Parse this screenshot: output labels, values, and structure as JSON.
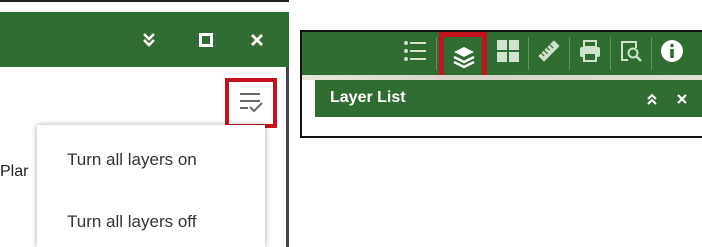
{
  "left_panel": {
    "header_icons": [
      "chevron-double-down-icon",
      "maximize-icon",
      "close-icon"
    ],
    "filter_icon": "layer-options-icon",
    "partial_text": "Plar",
    "menu": {
      "items": [
        {
          "label": "Turn all layers on"
        },
        {
          "label": "Turn all layers off"
        }
      ]
    }
  },
  "right_panel": {
    "toolbar": {
      "tools": [
        "legend-icon",
        "layers-icon",
        "basemap-gallery-icon",
        "measure-icon",
        "print-icon",
        "query-icon",
        "info-icon"
      ],
      "active_tool": "layers-icon"
    },
    "layer_list": {
      "title": "Layer List",
      "icons": [
        "chevron-double-up-icon",
        "close-icon"
      ]
    }
  },
  "colors": {
    "header_green": "#2f6d33",
    "highlight_red": "#c4131c",
    "menu_text": "#333333"
  }
}
